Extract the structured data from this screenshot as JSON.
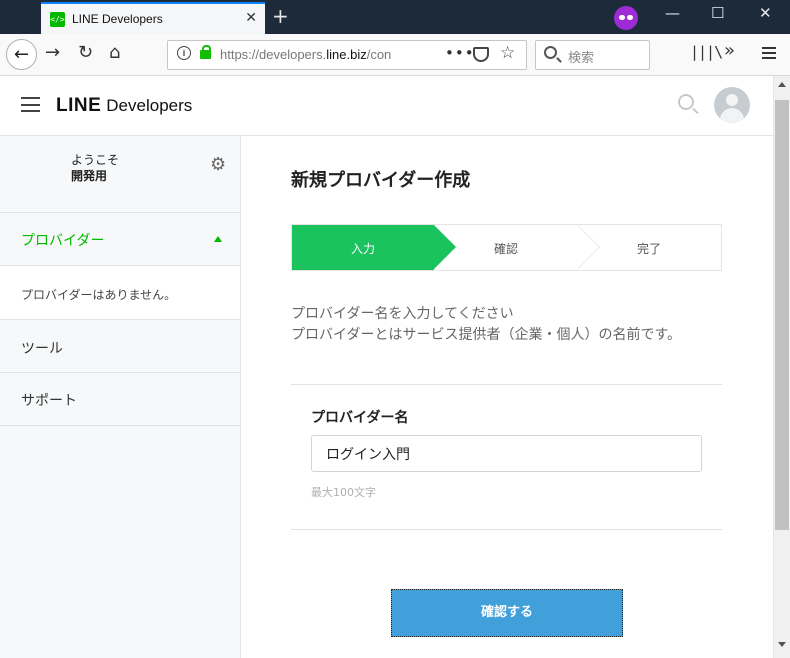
{
  "browser": {
    "tab_title": "LINE Developers",
    "favicon_text": "</>",
    "url_prefix": "https://developers.",
    "url_host": "line.biz",
    "url_suffix": "/con",
    "search_placeholder": "検索",
    "tab_close": "✕",
    "new_tab": "+",
    "minimize": "—",
    "maximize": "☐",
    "close": "✕"
  },
  "header": {
    "logo_line": "LINE",
    "logo_developers": "Developers"
  },
  "sidebar": {
    "welcome": "ようこそ",
    "user_name": "開発用",
    "providers_label": "プロバイダー",
    "no_providers": "プロバイダーはありません。",
    "tools_label": "ツール",
    "support_label": "サポート"
  },
  "main": {
    "title": "新規プロバイダー作成",
    "steps": [
      "入力",
      "確認",
      "完了"
    ],
    "active_step": 0,
    "desc_line1": "プロバイダー名を入力してください",
    "desc_line2": "プロバイダーとはサービス提供者（企業・個人）の名前です。",
    "field_label": "プロバイダー名",
    "field_value": "ログイン入門",
    "field_hint": "最大100文字",
    "confirm_button": "確認する"
  },
  "colors": {
    "accent_green": "#1ac35d",
    "line_green": "#00b900",
    "button_blue": "#419fd9"
  },
  "icons": [
    "back-icon",
    "forward-icon",
    "reload-icon",
    "home-icon",
    "info-icon",
    "lock-icon",
    "page-actions-icon",
    "pocket-icon",
    "bookmark-star-icon",
    "search-icon",
    "library-icon",
    "overflow-icon",
    "menu-icon",
    "private-mask-icon",
    "gear-icon",
    "avatar-icon"
  ]
}
